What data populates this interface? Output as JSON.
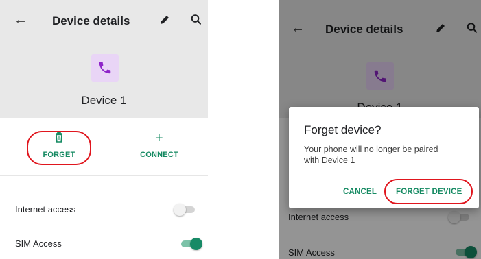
{
  "left": {
    "appbar": {
      "title": "Device details"
    },
    "device": {
      "name": "Device 1"
    },
    "actions": {
      "forget_label": "FORGET",
      "connect_label": "CONNECT"
    },
    "settings": [
      {
        "label": "Internet access",
        "enabled": false
      },
      {
        "label": "SIM Access",
        "enabled": true
      }
    ]
  },
  "right": {
    "appbar": {
      "title": "Device details"
    },
    "device": {
      "name": "Device 1"
    },
    "settings": [
      {
        "label": "Internet access",
        "enabled": false
      },
      {
        "label": "SIM Access",
        "enabled": true
      }
    ],
    "dialog": {
      "title": "Forget device?",
      "message": "Your phone will no longer be paired with Device 1",
      "cancel_label": "CANCEL",
      "confirm_label": "FORGET DEVICE"
    }
  },
  "icons": {
    "back": "arrow-left-icon",
    "edit": "pencil-icon",
    "search": "search-icon",
    "device": "phone-icon",
    "forget": "trash-icon",
    "connect": "plus-icon"
  },
  "colors": {
    "accent": "#158a62",
    "header_bg": "#e8e8e8",
    "device_icon_bg": "#e9d5f6",
    "device_icon_fg": "#8e24c9",
    "highlight": "#e0161e"
  }
}
